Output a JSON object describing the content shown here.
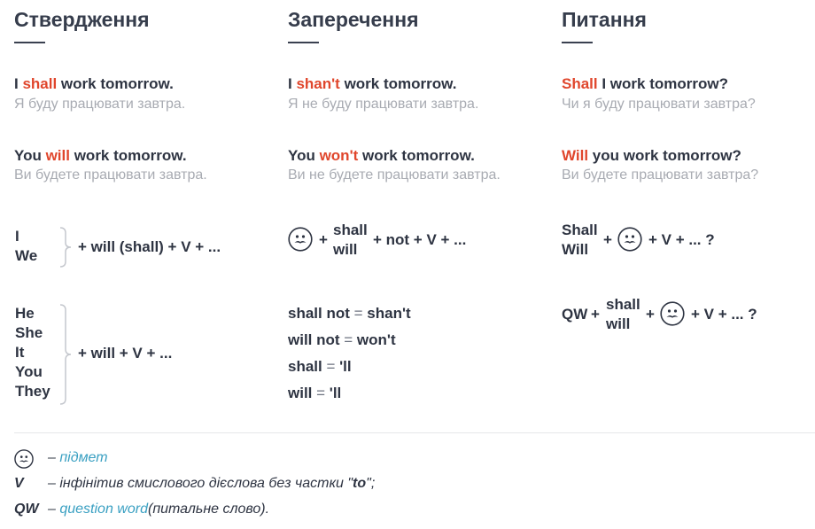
{
  "headers": {
    "affirmative": "Ствердження",
    "negative": "Заперечення",
    "question": "Питання"
  },
  "affirmative": {
    "ex1": {
      "pre": "I ",
      "aux": "shall",
      "post": " work tomorrow.",
      "translation": "Я буду працювати завтра."
    },
    "ex2": {
      "pre": "You ",
      "aux": "will",
      "post": " work tomorrow.",
      "translation": "Ви будете працювати завтра."
    },
    "group1": {
      "pronouns": [
        "I",
        "We"
      ],
      "formula": "+ will (shall) + V + ..."
    },
    "group2": {
      "pronouns": [
        "He",
        "She",
        "It",
        "You",
        "They"
      ],
      "formula": "+ will + V + ..."
    }
  },
  "negative": {
    "ex1": {
      "pre": "I ",
      "aux": "shan't",
      "post": " work tomorrow.",
      "translation": "Я не буду працювати завтра."
    },
    "ex2": {
      "pre": "You ",
      "aux": "won't",
      "post": " work tomorrow.",
      "translation": "Ви не будете працювати завтра."
    },
    "formula": {
      "plus1": "+",
      "aux_top": "shall",
      "aux_bottom": "will",
      "rest": "+ not + V + ..."
    },
    "contractions": [
      {
        "full": "shall not",
        "eq": " = ",
        "short": "shan't"
      },
      {
        "full": "will not",
        "eq": " = ",
        "short": "won't"
      },
      {
        "full": "shall",
        "eq": " = ",
        "short": "'ll"
      },
      {
        "full": "will",
        "eq": " = ",
        "short": "'ll"
      }
    ]
  },
  "question": {
    "ex1": {
      "aux": "Shall",
      "post": " I work tomorrow?",
      "translation": "Чи я буду працювати завтра?"
    },
    "ex2": {
      "aux": "Will",
      "post": " you work tomorrow?",
      "translation": "Ви будете працювати завтра?"
    },
    "formula1": {
      "aux_top": "Shall",
      "aux_bottom": "Will",
      "plus1": "+",
      "rest": "+ V + ... ?"
    },
    "formula2": {
      "qw": "QW",
      "plus1": "+",
      "aux_top": "shall",
      "aux_bottom": "will",
      "plus2": "+",
      "rest": "+ V + ... ?"
    }
  },
  "legend": {
    "subject": {
      "icon": "subject-face-icon",
      "dash": "–",
      "text": "підмет"
    },
    "verb": {
      "key": "V",
      "dash": "–",
      "text": "інфінітив смислового дієслова без частки \"",
      "to": "to",
      "after": "\";"
    },
    "qw": {
      "key": "QW",
      "dash": "–",
      "text1": "question word",
      "text2": "(питальне слово)."
    }
  },
  "colors": {
    "accent_red": "#e0462c",
    "link_blue": "#3aa0c2",
    "text": "#2e3442",
    "muted": "#a8abb2"
  }
}
